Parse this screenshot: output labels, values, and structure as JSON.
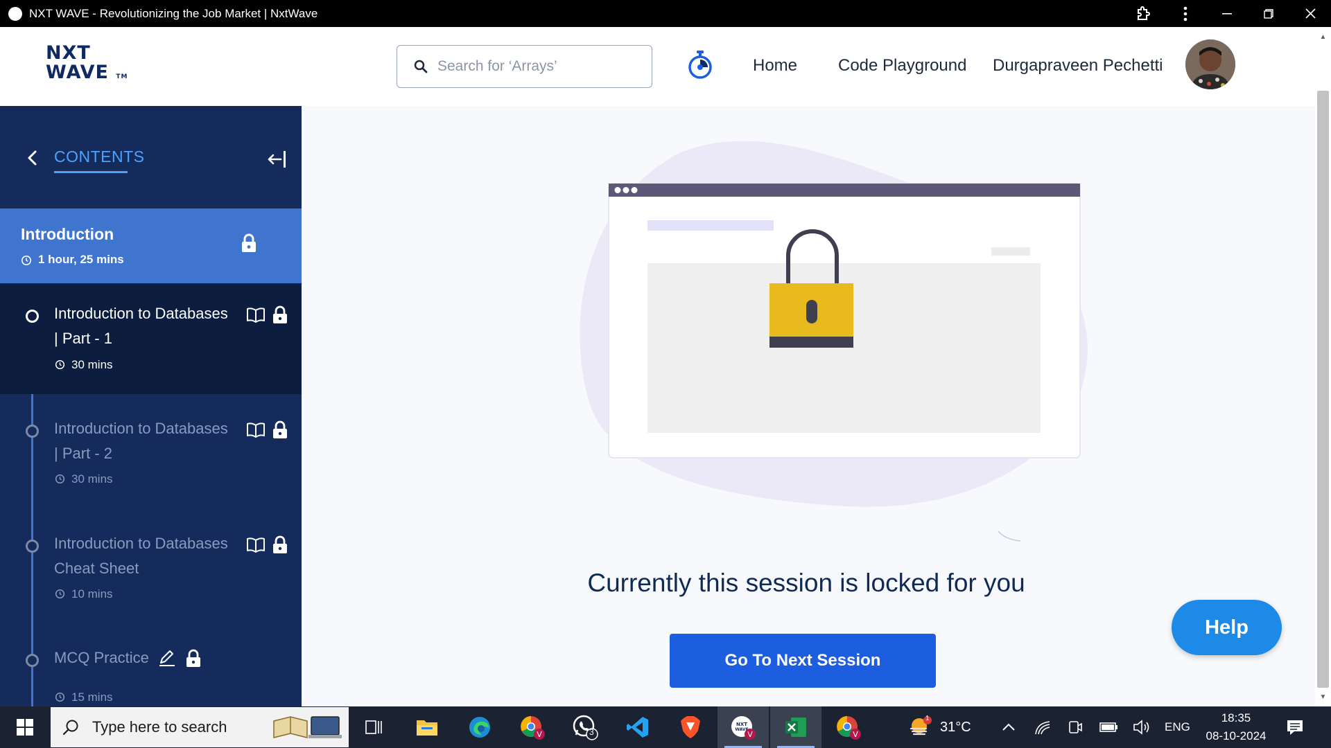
{
  "window": {
    "title": "NXT WAVE - Revolutionizing the Job Market | NxtWave",
    "favicon_text": "NXT WAVE"
  },
  "header": {
    "logo_line1": "NXT",
    "logo_line2": "WAVE",
    "logo_tm": "TM",
    "search_placeholder": "Search for ‘Arrays’",
    "nav_home": "Home",
    "nav_code": "Code Playground",
    "user_name": "Durgapraveen Pechetti"
  },
  "sidebar": {
    "title": "CONTENTS",
    "module": {
      "name": "Introduction",
      "duration": "1 hour, 25 mins"
    },
    "items": [
      {
        "line1": "Introduction to Databases",
        "line2": "| Part - 1",
        "duration": "30 mins",
        "type": "reading",
        "active": true
      },
      {
        "line1": "Introduction to Databases",
        "line2": "| Part - 2",
        "duration": "30 mins",
        "type": "reading",
        "active": false
      },
      {
        "line1": "Introduction to Databases",
        "line2": "Cheat Sheet",
        "duration": "10 mins",
        "type": "reading",
        "active": false
      },
      {
        "line1": "MCQ Practice",
        "line2": "",
        "duration": "15 mins",
        "type": "practice",
        "active": false
      }
    ]
  },
  "main": {
    "locked_message": "Currently this session is locked for you",
    "next_button": "Go To Next Session",
    "help_button": "Help"
  },
  "taskbar": {
    "search_placeholder": "Type here to search",
    "whatsapp_badge": "3",
    "weather_badge": "1",
    "temperature": "31°C",
    "language": "ENG",
    "time": "18:35",
    "date": "08-10-2024"
  },
  "colors": {
    "sidebar_bg": "#152b5c",
    "module_bg": "#3f74cf",
    "accent_link": "#4aa3ff",
    "primary_button": "#1d5ee0",
    "help_button": "#1d8ae8",
    "lock_yellow": "#e8ba1e"
  }
}
